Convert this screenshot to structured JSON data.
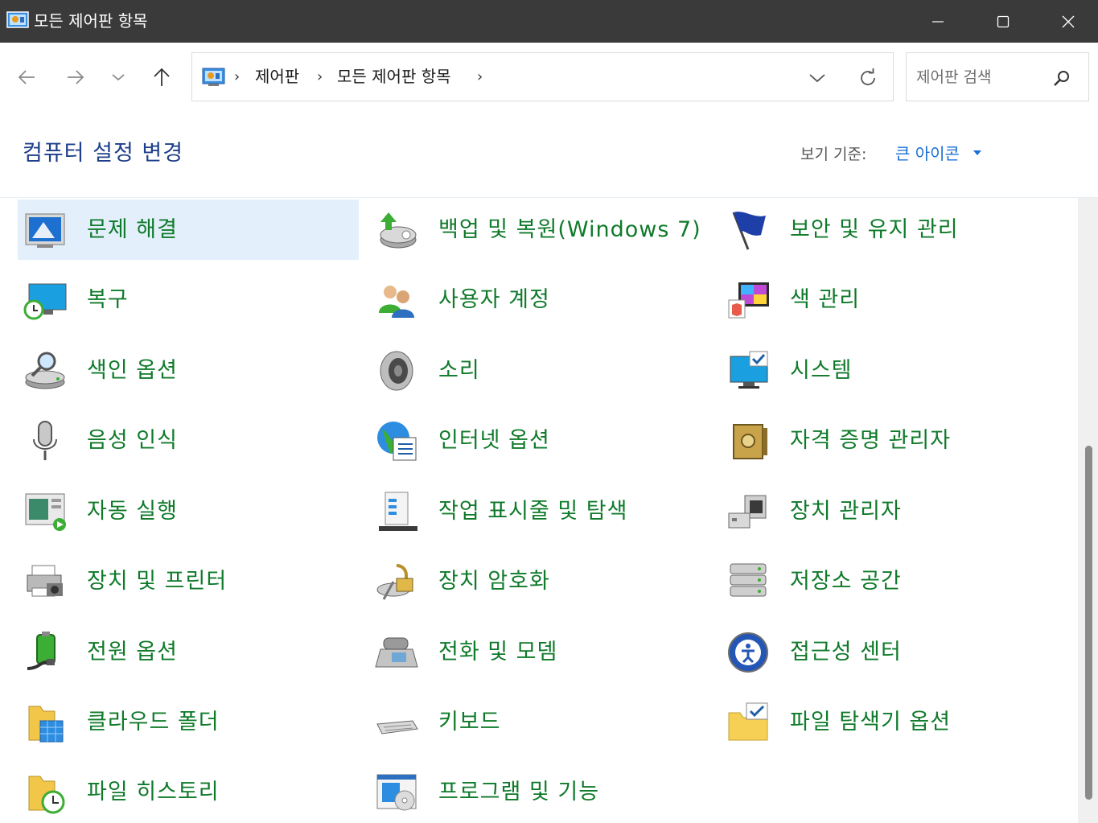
{
  "window": {
    "title": "모든 제어판 항목"
  },
  "nav": {
    "breadcrumbs": [
      "제어판",
      "모든 제어판 항목"
    ],
    "search_placeholder": "제어판 검색"
  },
  "header": {
    "title": "컴퓨터 설정 변경",
    "view_label": "보기 기준:",
    "view_value": "큰 아이콘"
  },
  "items": [
    {
      "label": "문제 해결",
      "icon": "troubleshooting-icon",
      "selected": true
    },
    {
      "label": "백업 및 복원(Windows 7)",
      "icon": "backup-restore-icon"
    },
    {
      "label": "보안 및 유지 관리",
      "icon": "flag-icon"
    },
    {
      "label": "복구",
      "icon": "recovery-icon"
    },
    {
      "label": "사용자 계정",
      "icon": "user-accounts-icon"
    },
    {
      "label": "색 관리",
      "icon": "color-management-icon"
    },
    {
      "label": "색인 옵션",
      "icon": "indexing-icon"
    },
    {
      "label": "소리",
      "icon": "speaker-icon"
    },
    {
      "label": "시스템",
      "icon": "system-icon"
    },
    {
      "label": "음성 인식",
      "icon": "microphone-icon"
    },
    {
      "label": "인터넷 옵션",
      "icon": "internet-options-icon"
    },
    {
      "label": "자격 증명 관리자",
      "icon": "credential-vault-icon"
    },
    {
      "label": "자동 실행",
      "icon": "autoplay-icon"
    },
    {
      "label": "작업 표시줄 및 탐색",
      "icon": "taskbar-icon"
    },
    {
      "label": "장치 관리자",
      "icon": "device-manager-icon"
    },
    {
      "label": "장치 및 프린터",
      "icon": "printer-icon"
    },
    {
      "label": "장치 암호화",
      "icon": "device-encryption-icon"
    },
    {
      "label": "저장소 공간",
      "icon": "storage-spaces-icon"
    },
    {
      "label": "전원 옵션",
      "icon": "power-options-icon"
    },
    {
      "label": "전화 및 모뎀",
      "icon": "phone-modem-icon"
    },
    {
      "label": "접근성 센터",
      "icon": "ease-of-access-icon"
    },
    {
      "label": "클라우드 폴더",
      "icon": "cloud-folder-icon"
    },
    {
      "label": "키보드",
      "icon": "keyboard-icon"
    },
    {
      "label": "파일 탐색기 옵션",
      "icon": "folder-options-icon"
    },
    {
      "label": "파일 히스토리",
      "icon": "file-history-icon"
    },
    {
      "label": "프로그램 및 기능",
      "icon": "programs-features-icon"
    }
  ]
}
